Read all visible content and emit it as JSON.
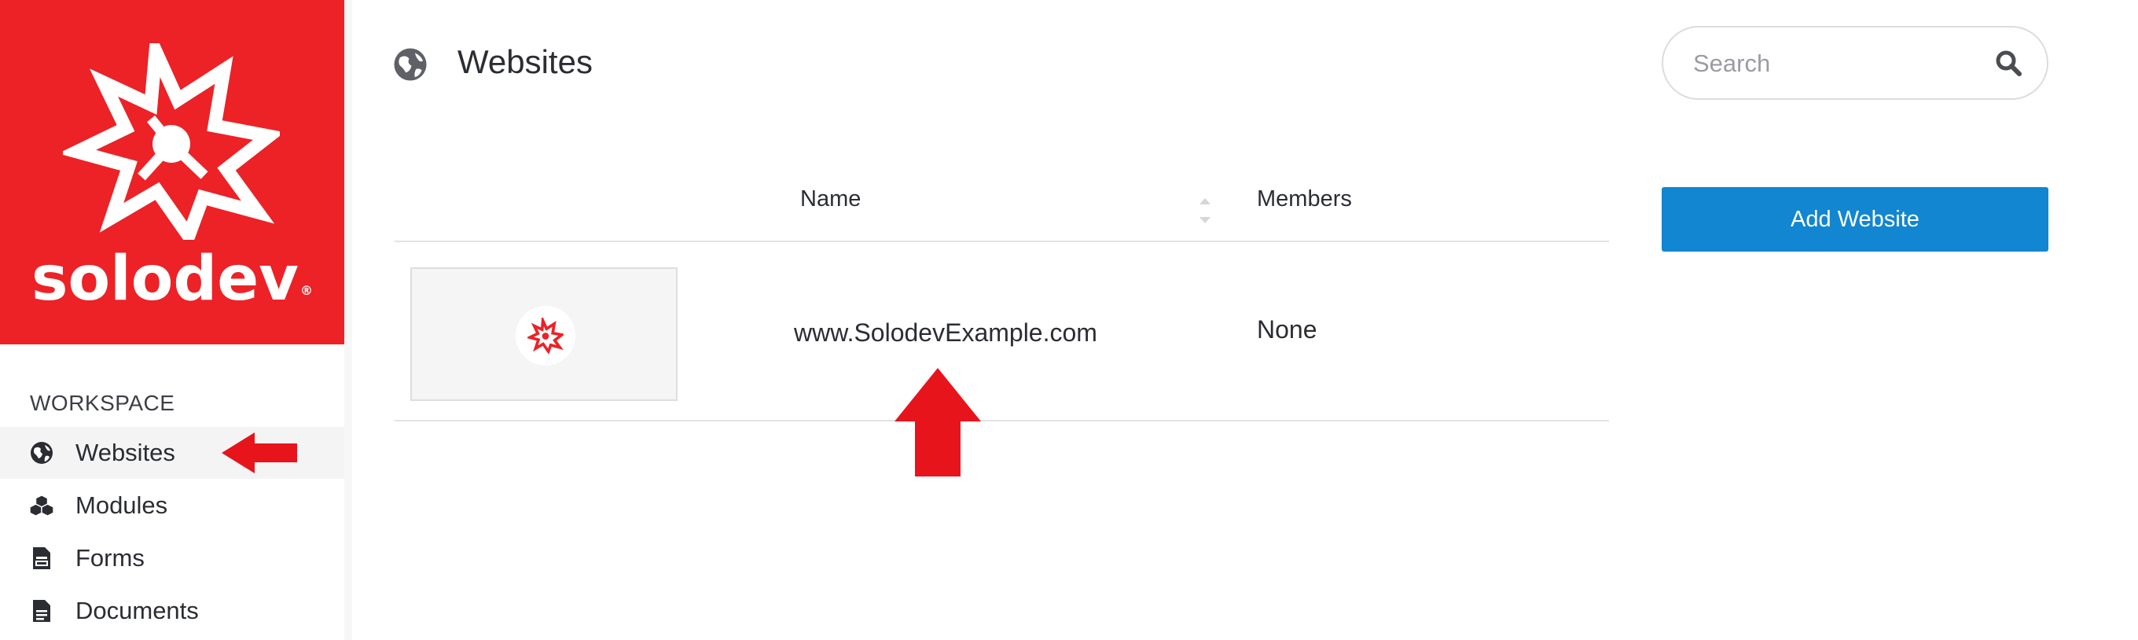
{
  "brand": {
    "name": "solodev",
    "registered_mark": "®",
    "color": "#ec2227"
  },
  "sidebar": {
    "section_label": "WORKSPACE",
    "items": [
      {
        "label": "Websites",
        "icon": "globe-icon",
        "active": true
      },
      {
        "label": "Modules",
        "icon": "cubes-icon",
        "active": false
      },
      {
        "label": "Forms",
        "icon": "form-icon",
        "active": false
      },
      {
        "label": "Documents",
        "icon": "document-icon",
        "active": false
      }
    ]
  },
  "header": {
    "title": "Websites",
    "icon": "globe-icon"
  },
  "search": {
    "placeholder": "Search",
    "value": "",
    "icon": "search-icon"
  },
  "actions": {
    "add_label": "Add Website",
    "accent": "#1286d0"
  },
  "table": {
    "columns": [
      "Name",
      "Members"
    ],
    "rows": [
      {
        "thumbnail_icon": "solodev-logo-icon",
        "name": "www.SolodevExample.com",
        "members": "None"
      }
    ]
  },
  "annotations": {
    "arrow_color": "#e8141c"
  }
}
